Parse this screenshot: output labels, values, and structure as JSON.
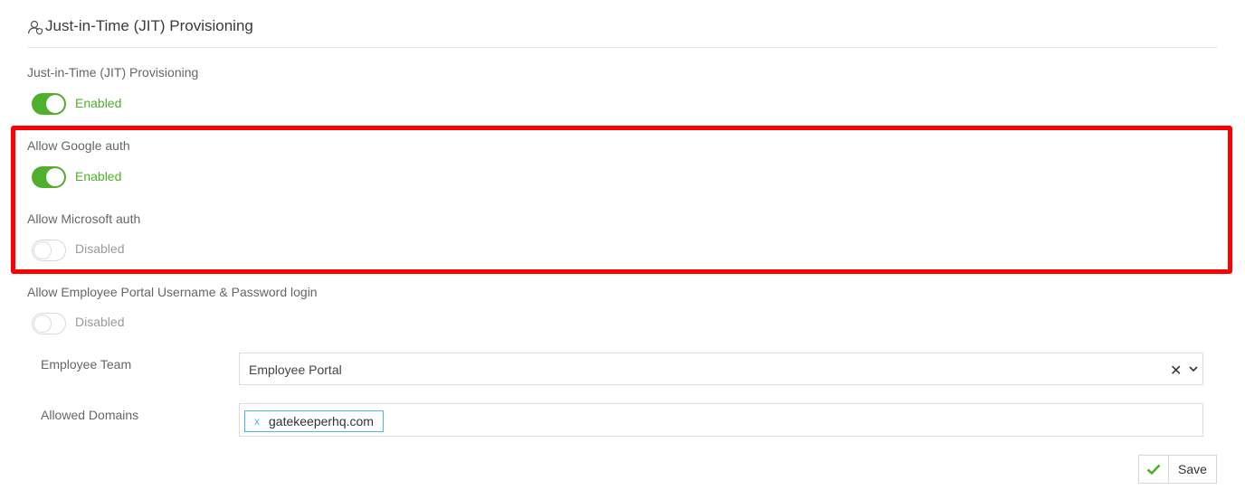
{
  "header": {
    "title": "Just-in-Time (JIT) Provisioning",
    "icon": "user-shield-icon"
  },
  "settings": [
    {
      "label": "Just-in-Time (JIT) Provisioning",
      "enabled": true,
      "state": "Enabled"
    },
    {
      "label": "Allow Google auth",
      "enabled": true,
      "state": "Enabled"
    },
    {
      "label": "Allow Microsoft auth",
      "enabled": false,
      "state": "Disabled"
    },
    {
      "label": "Allow Employee Portal Username & Password login",
      "enabled": false,
      "state": "Disabled"
    }
  ],
  "employee_team": {
    "label": "Employee Team",
    "value": "Employee Portal",
    "clear_icon": "close-icon",
    "dropdown_icon": "chevron-down-icon"
  },
  "allowed_domains": {
    "label": "Allowed Domains",
    "tags": [
      "gatekeeperhq.com"
    ],
    "remove_glyph": "x"
  },
  "save": {
    "label": "Save",
    "icon": "check-icon"
  },
  "colors": {
    "enabled": "#4fb02e",
    "highlight": "#ff0000",
    "tag_border": "#4db6e3"
  }
}
